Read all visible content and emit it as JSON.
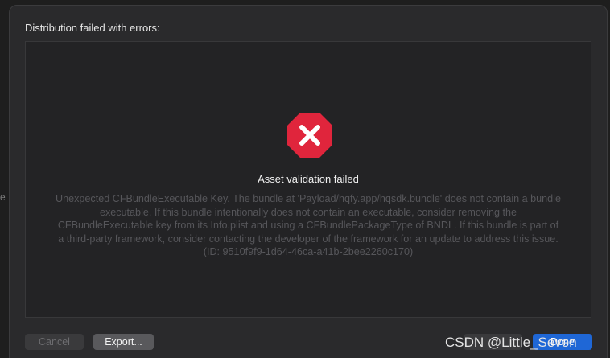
{
  "background": {
    "edge_char": "e"
  },
  "dialog": {
    "title": "Distribution failed with errors:",
    "status_icon": "error-octagon-icon",
    "status_title": "Asset validation failed",
    "status_message": "Unexpected CFBundleExecutable Key. The bundle at 'Payload/hqfy.app/hqsdk.bundle' does not contain a bundle executable. If this bundle intentionally does not contain an executable, consider removing the CFBundleExecutable key from its Info.plist and using a CFBundlePackageType of BNDL. If this bundle is part of a third-party framework, consider contacting the developer of the framework for an update to address this issue. (ID: 9510f9f9-1d64-46ca-a41b-2bee2260c170)"
  },
  "buttons": {
    "cancel": "Cancel",
    "export": "Export...",
    "previous": "",
    "done": "Done"
  },
  "watermark": "CSDN @Little_Seven",
  "colors": {
    "sheet_bg": "#2a2a2c",
    "error_red": "#e0253c",
    "done_blue": "#1f67d6",
    "message_gray": "#56565a"
  }
}
